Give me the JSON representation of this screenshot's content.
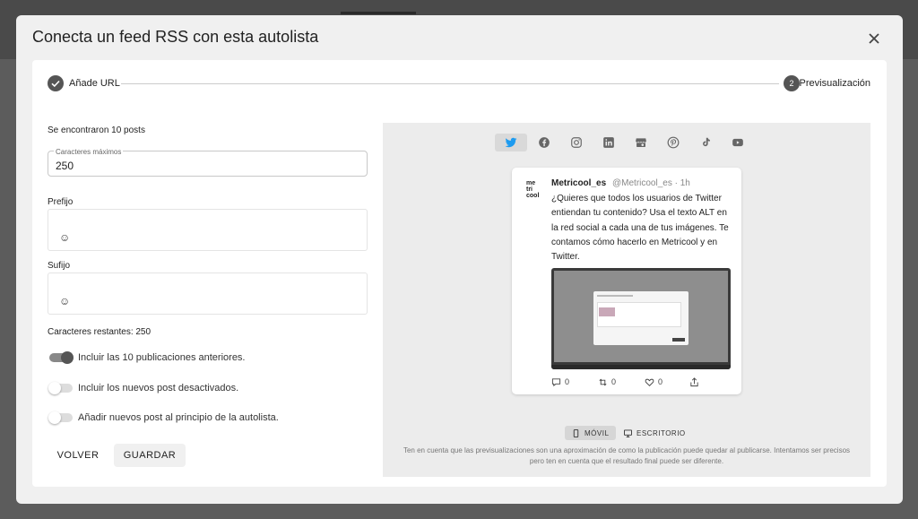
{
  "modal": {
    "title": "Conecta un feed RSS con esta autolista"
  },
  "stepper": {
    "step1_label": "Añade URL",
    "step2_number": "2",
    "step2_label": "Previsualización"
  },
  "form": {
    "found_text": "Se encontraron 10 posts",
    "max_chars_label": "Caracteres máximos",
    "max_chars_value": "250",
    "prefix_label": "Prefijo",
    "suffix_label": "Sufijo",
    "emoji_glyph": "☺",
    "remaining_text": "Caracteres restantes: 250",
    "toggles": [
      {
        "label": "Incluir las 10 publicaciones anteriores.",
        "on": true
      },
      {
        "label": "Incluir los nuevos post desactivados.",
        "on": false
      },
      {
        "label": "Añadir nuevos post al principio de la autolista.",
        "on": false
      }
    ],
    "back_label": "VOLVER",
    "save_label": "GUARDAR"
  },
  "preview": {
    "networks": [
      "twitter-icon",
      "facebook-icon",
      "instagram-icon",
      "linkedin-icon",
      "google-business-icon",
      "pinterest-icon",
      "tiktok-icon",
      "youtube-icon"
    ],
    "active_network": "twitter-icon",
    "brand_logo": [
      "me",
      "tri",
      "cool"
    ],
    "account_name": "Metricool_es",
    "account_handle": "@Metricool_es · 1h",
    "tweet_text": "¿Quieres que todos los usuarios de Twitter entiendan tu contenido? Usa el texto ALT en la red social a cada una de tus imágenes. Te contamos cómo hacerlo en Metricool y en Twitter.",
    "actions": {
      "replies": "0",
      "retweets": "0",
      "likes": "0"
    },
    "device_mobile": "MÓVIL",
    "device_desktop": "ESCRITORIO",
    "disclaimer": "Ten en cuenta que las previsualizaciones son una aproximación de como la publicación puede quedar al publicarse. Intentamos ser precisos pero ten en cuenta que el resultado final puede ser diferente."
  }
}
